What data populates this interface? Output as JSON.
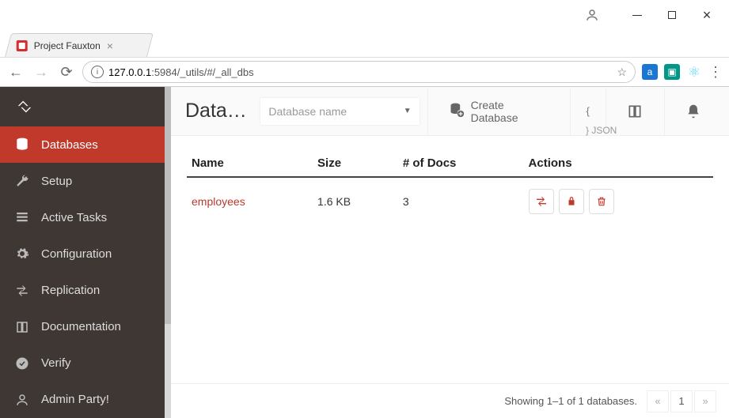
{
  "window": {
    "tab_title": "Project Fauxton"
  },
  "address_bar": {
    "url_host": "127.0.0.1",
    "url_port_path": ":5984/_utils/#/_all_dbs"
  },
  "sidebar": {
    "items": [
      {
        "label": "Databases",
        "active": true
      },
      {
        "label": "Setup"
      },
      {
        "label": "Active Tasks"
      },
      {
        "label": "Configuration"
      },
      {
        "label": "Replication"
      },
      {
        "label": "Documentation"
      },
      {
        "label": "Verify"
      },
      {
        "label": "Admin Party!"
      }
    ]
  },
  "topbar": {
    "title": "Data…",
    "search_placeholder": "Database name",
    "create_label": "Create Database",
    "json_top": "{",
    "json_bottom": "} JSON"
  },
  "table": {
    "headers": {
      "name": "Name",
      "size": "Size",
      "docs": "# of Docs",
      "actions": "Actions"
    },
    "rows": [
      {
        "name": "employees",
        "size": "1.6 KB",
        "docs": "3"
      }
    ]
  },
  "footer": {
    "status": "Showing 1–1 of 1 databases.",
    "page": "1",
    "prev": "«",
    "next": "»"
  }
}
